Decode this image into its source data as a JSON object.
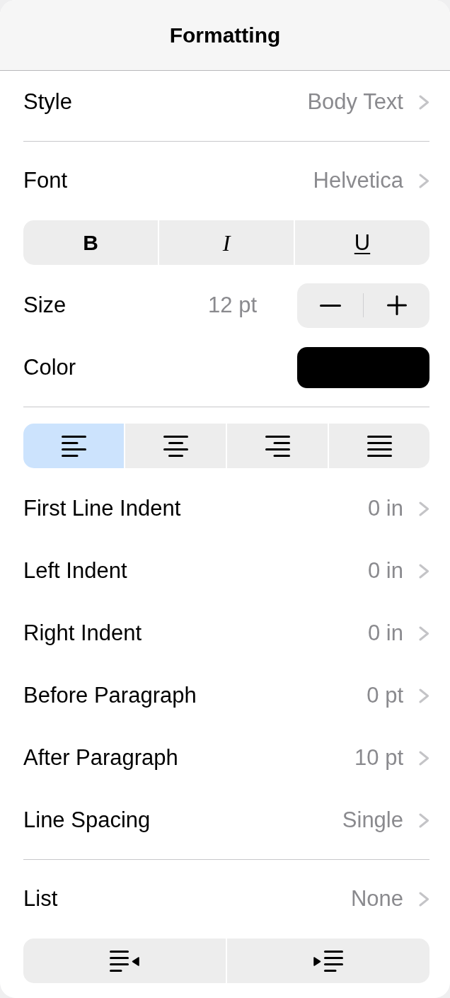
{
  "header": {
    "title": "Formatting"
  },
  "groups": [
    {
      "items": [
        {
          "kind": "nav",
          "label": "Style",
          "value": "Body Text"
        }
      ]
    },
    {
      "items": [
        {
          "kind": "nav",
          "label": "Font",
          "value": "Helvetica"
        },
        {
          "kind": "segmented",
          "segments": [
            {
              "kind": "bold",
              "label": "B",
              "selected": false
            },
            {
              "kind": "italic",
              "label": "I",
              "selected": false
            },
            {
              "kind": "underline",
              "label": "U",
              "selected": false
            }
          ]
        },
        {
          "kind": "stepper",
          "label": "Size",
          "value": "12 pt"
        },
        {
          "kind": "color",
          "label": "Color",
          "color": "#000000"
        }
      ]
    },
    {
      "items": [
        {
          "kind": "segmented",
          "segments": [
            {
              "kind": "align-left",
              "selected": true
            },
            {
              "kind": "align-center",
              "selected": false
            },
            {
              "kind": "align-right",
              "selected": false
            },
            {
              "kind": "justify",
              "selected": false
            }
          ]
        },
        {
          "kind": "nav",
          "label": "First Line Indent",
          "value": "0 in"
        },
        {
          "kind": "nav",
          "label": "Left Indent",
          "value": "0 in"
        },
        {
          "kind": "nav",
          "label": "Right Indent",
          "value": "0 in"
        },
        {
          "kind": "nav",
          "label": "Before Paragraph",
          "value": "0 pt"
        },
        {
          "kind": "nav",
          "label": "After Paragraph",
          "value": "10 pt"
        },
        {
          "kind": "nav",
          "label": "Line Spacing",
          "value": "Single"
        }
      ]
    },
    {
      "items": [
        {
          "kind": "nav",
          "label": "List",
          "value": "None"
        },
        {
          "kind": "segmented",
          "segments": [
            {
              "kind": "outdent"
            },
            {
              "kind": "indent"
            }
          ]
        }
      ]
    }
  ]
}
